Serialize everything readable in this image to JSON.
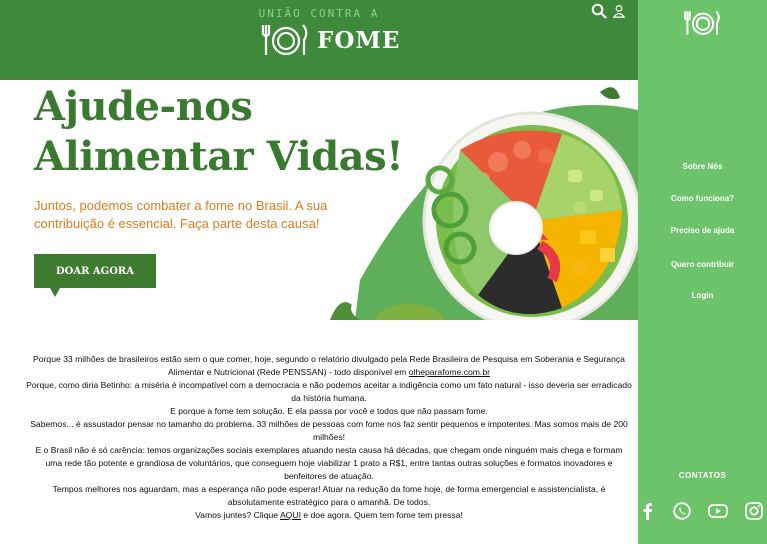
{
  "header": {
    "tagline": "UNIÃO CONTRA A",
    "brand_name": "FOME",
    "icons": [
      "search-icon",
      "user-icon"
    ]
  },
  "sidebar": {
    "items": [
      {
        "label": "Sobre Nós"
      },
      {
        "label": "Como funciona?"
      },
      {
        "label": "Preciso de ajuda"
      },
      {
        "label": "Quero contribuir"
      },
      {
        "label": "Login"
      }
    ],
    "contacts_label": "CONTATOS",
    "social_icons": [
      "facebook-icon",
      "whatsapp-icon",
      "youtube-icon",
      "instagram-icon"
    ]
  },
  "hero": {
    "title_line1": "Ajude-nos",
    "title_line2": "Alimentar Vidas!",
    "subtitle": "Juntos, podemos combater a fome no Brasil. A sua contribuição é essencial. Faça parte desta causa!",
    "donate_label": "DOAR AGORA"
  },
  "body": {
    "p1_before": "Porque 33 milhões de brasileiros estão sem o que comer, hoje, segundo o relatório divulgado pela Rede Brasileira de Pesquisa em Soberania e Segurança Alimentar e Nutricional (Rede PENSSAN) - todo disponível em ",
    "p1_link": "olheparafome.com.br",
    "p2": "Porque, como diria Betinho: a miséria é incompatível com a democracia e não podemos aceitar a indigência como um fato natural - isso deveria ser erradicado da história humana.",
    "p3": "E porque a fome tem solução. E ela passa por você e todos que não passam fome.",
    "p4": "Sabemos... é assustador pensar no tamanho do problema. 33 milhões de pessoas com fome nos faz sentir pequenos e impotentes. Mas somos mais de 200 milhões!",
    "p5": "E o Brasil não é só carência: temos organizações sociais exemplares atuando nesta causa há décadas, que chegam onde ninguém mais chega e formam uma rede tão potente e grandiosa de voluntários, que conseguem hoje viabilizar 1 prato a R$1, entre tantas outras soluções e formatos inovadores e benfeitores de atuação.",
    "p6": "Tempos melhores nos aguardam, mas a esperança não pode esperar! Atuar na redução da fome hoje, de forma emergencial e assistencialista, é absolutamente estratégico para o amanhã. De todos.",
    "p7_before": "Vamos juntes? Clique ",
    "p7_link": "AQUI",
    "p7_after": " e doe agora. Quem tem fome tem pressa!"
  },
  "colors": {
    "header_green": "#3e8a3a",
    "sidebar_green": "#6cc36a",
    "title_green": "#3a7a30",
    "subtitle_orange": "#e07b22",
    "button_green": "#3e7a30"
  }
}
